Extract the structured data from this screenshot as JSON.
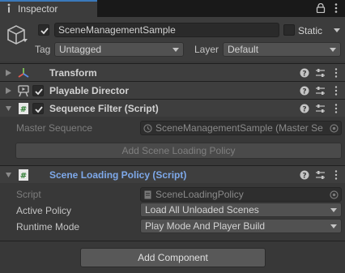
{
  "window": {
    "tab_title": "Inspector"
  },
  "game_object": {
    "name": "SceneManagementSample",
    "active": true,
    "static_label": "Static",
    "static": false,
    "tag_label": "Tag",
    "tag_value": "Untagged",
    "layer_label": "Layer",
    "layer_value": "Default"
  },
  "components": [
    {
      "title": "Transform",
      "has_checkbox": false,
      "icon": "transform-axes-icon"
    },
    {
      "title": "Playable Director",
      "has_checkbox": true,
      "enabled": true,
      "icon": "playable-director-icon"
    },
    {
      "title": "Sequence Filter (Script)",
      "has_checkbox": true,
      "enabled": true,
      "icon": "script-icon"
    },
    {
      "title": "Scene Loading Policy (Script)",
      "has_checkbox": false,
      "icon": "script-icon"
    }
  ],
  "sequence_filter": {
    "master_sequence_label": "Master Sequence",
    "master_sequence_value": "SceneManagementSample (Master Se",
    "add_policy_button": "Add Scene Loading Policy"
  },
  "scene_loading_policy": {
    "script_label": "Script",
    "script_value": "SceneLoadingPolicy",
    "active_policy_label": "Active Policy",
    "active_policy_value": "Load All Unloaded Scenes",
    "runtime_mode_label": "Runtime Mode",
    "runtime_mode_value": "Play Mode And Player Build"
  },
  "footer": {
    "add_component_button": "Add Component"
  },
  "colors": {
    "background": "#383838",
    "header": "#3e3e3e",
    "accent_tab": "#3a79bb",
    "selected_title": "#7ea9ea"
  }
}
